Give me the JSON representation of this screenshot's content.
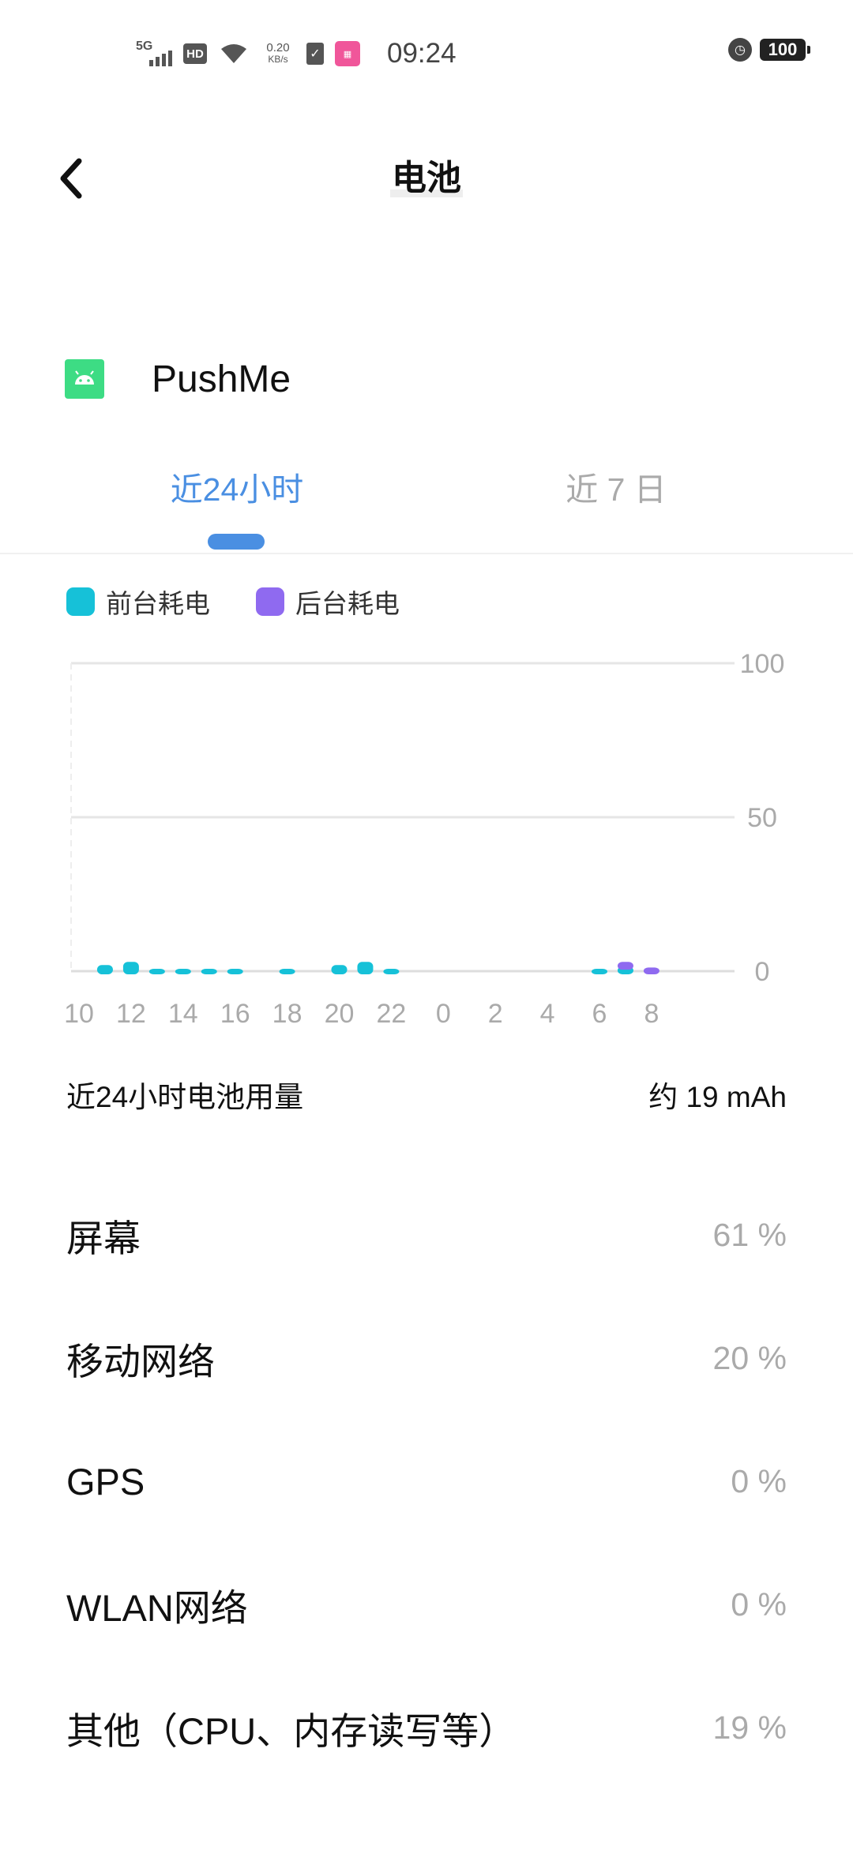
{
  "status_bar": {
    "network": "5G",
    "hd": "HD",
    "speed_value": "0.20",
    "speed_unit": "KB/s",
    "time": "09:24",
    "battery": "100",
    "icons": [
      "signal-icon",
      "hd-icon",
      "wifi-icon",
      "clipboard-icon",
      "app-notification-icon",
      "alarm-icon",
      "battery-icon"
    ]
  },
  "header": {
    "title": "电池",
    "back_icon": "chevron-left-icon"
  },
  "app": {
    "name": "PushMe",
    "icon": "android-icon",
    "icon_color": "#3ddc84"
  },
  "tabs": [
    {
      "label": "近24小时",
      "active": true
    },
    {
      "label": "近 7 日",
      "active": false
    }
  ],
  "legend": [
    {
      "label": "前台耗电",
      "color": "#16c1d8"
    },
    {
      "label": "后台耗电",
      "color": "#8f6af0"
    }
  ],
  "chart_data": {
    "type": "bar",
    "stacked": true,
    "x_tick_labels": [
      "10",
      "12",
      "14",
      "16",
      "18",
      "20",
      "22",
      "0",
      "2",
      "4",
      "6",
      "8"
    ],
    "y_tick_labels": [
      "100",
      "50",
      "0"
    ],
    "ylim": [
      0,
      100
    ],
    "categories": [
      "10",
      "11",
      "12",
      "13",
      "14",
      "15",
      "16",
      "17",
      "18",
      "19",
      "20",
      "21",
      "22",
      "23",
      "0",
      "1",
      "2",
      "3",
      "4",
      "5",
      "6",
      "7",
      "8"
    ],
    "series": [
      {
        "name": "前台耗电",
        "color": "#16c1d8",
        "values": [
          0,
          2,
          3,
          0.5,
          0.5,
          0.5,
          0.5,
          0,
          0.2,
          0,
          2,
          3,
          0.5,
          0,
          0,
          0,
          0,
          0,
          0,
          0,
          0.5,
          1.5,
          0
        ]
      },
      {
        "name": "后台耗电",
        "color": "#8f6af0",
        "values": [
          0,
          0,
          0,
          0,
          0,
          0,
          0,
          0,
          0,
          0,
          0,
          0,
          0,
          0,
          0,
          0,
          0,
          0,
          0,
          0,
          0,
          1.5,
          1.2
        ]
      }
    ],
    "grid": true
  },
  "usage": {
    "label": "近24小时电池用量",
    "value": "约 19 mAh"
  },
  "breakdown": [
    {
      "label": "屏幕",
      "value": "61 %"
    },
    {
      "label": "移动网络",
      "value": "20 %"
    },
    {
      "label": "GPS",
      "value": "0 %"
    },
    {
      "label": "WLAN网络",
      "value": "0 %"
    },
    {
      "label": "其他（CPU、内存读写等）",
      "value": "19 %"
    }
  ]
}
